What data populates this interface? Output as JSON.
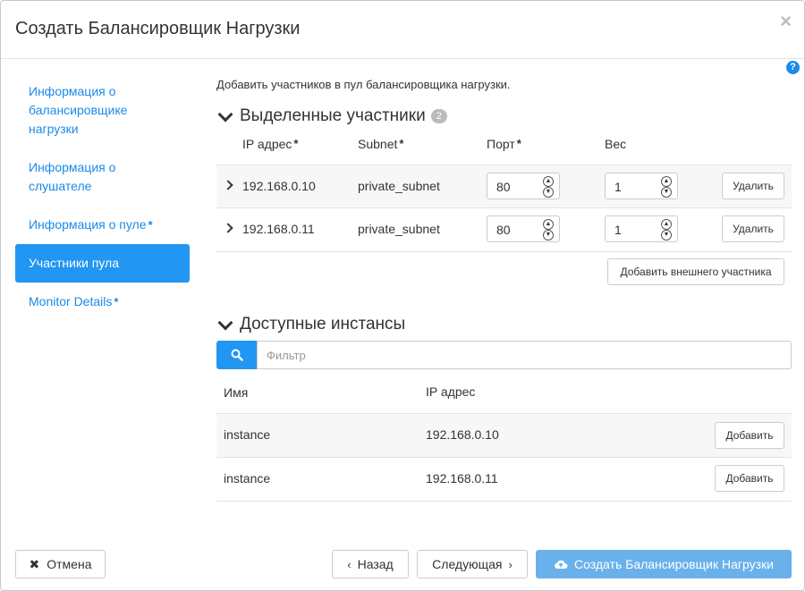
{
  "modal": {
    "title": "Создать Балансировщик Нагрузки",
    "close": "×",
    "help": "?"
  },
  "sidebar": {
    "items": [
      {
        "label": "Информация о балансировщике нагрузки",
        "required": ""
      },
      {
        "label": "Информация о слушателе",
        "required": ""
      },
      {
        "label": "Информация о пуле",
        "required": "*"
      },
      {
        "label": "Участники пула",
        "required": ""
      },
      {
        "label": "Monitor Details",
        "required": "*"
      }
    ],
    "active_index": 3
  },
  "main": {
    "intro": "Добавить участников в пул балансировщика нагрузки.",
    "allocated": {
      "title": "Выделенные участники",
      "count": "2",
      "columns": {
        "ip": "IP адрес",
        "ip_req": "*",
        "subnet": "Subnet",
        "subnet_req": "*",
        "port": "Порт",
        "port_req": "*",
        "weight": "Вес"
      },
      "rows": [
        {
          "ip": "192.168.0.10",
          "subnet": "private_subnet",
          "port": "80",
          "weight": "1",
          "delete": "Удалить"
        },
        {
          "ip": "192.168.0.11",
          "subnet": "private_subnet",
          "port": "80",
          "weight": "1",
          "delete": "Удалить"
        }
      ],
      "add_external": "Добавить внешнего участника"
    },
    "available": {
      "title": "Доступные инстансы",
      "filter_placeholder": "Фильтр",
      "columns": {
        "name": "Имя",
        "ip": "IP адрес"
      },
      "rows": [
        {
          "name": "instance",
          "ip": "192.168.0.10",
          "add": "Добавить"
        },
        {
          "name": "instance",
          "ip": "192.168.0.11",
          "add": "Добавить"
        }
      ]
    }
  },
  "footer": {
    "cancel": "Отмена",
    "back": "Назад",
    "next": "Следующая",
    "create": "Создать Балансировщик Нагрузки"
  },
  "colors": {
    "accent": "#2196f3",
    "link": "#1a8ae8",
    "primary_disabled": "#6ab1ec"
  },
  "icons": {
    "close": "close-icon",
    "help": "help-icon",
    "search": "search-icon",
    "cancel": "x-icon",
    "back": "chevron-left-icon",
    "next": "chevron-right-icon",
    "create": "cloud-upload-icon"
  }
}
